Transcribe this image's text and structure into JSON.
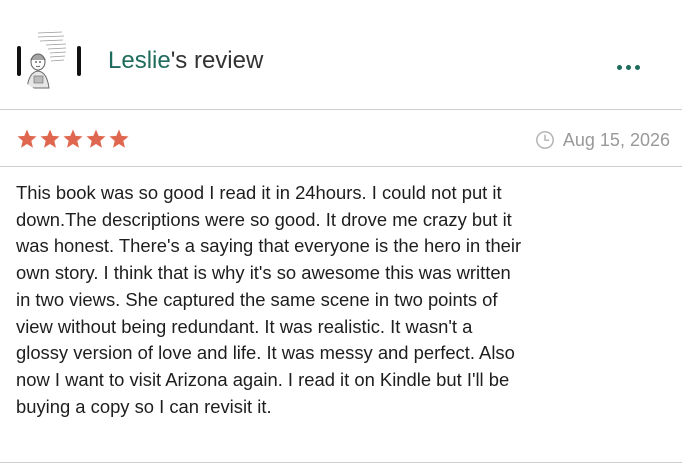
{
  "review": {
    "user_name": "Leslie",
    "title_suffix": "'s review",
    "rating": 5,
    "rating_max": 5,
    "date": "Aug 15, 2026",
    "body": "This book was so good I read it in 24hours. I could not put it\ndown.The descriptions were so good. It drove me crazy but it\nwas honest. There's a saying that everyone is the hero in their\nown story. I think that is why it's so awesome this was written\nin two views. She captured the same scene in two points of\nview without being redundant. It was realistic. It wasn't a\nglossy version of love and life. It was messy and perfect. Also\nnow I want to visit Arizona again. I read it on Kindle but I'll be\nbuying a copy so I can revisit it."
  },
  "colors": {
    "accent": "#1f6b5c",
    "star": "#e0674f",
    "muted": "#999999",
    "divider": "#cfcfcf"
  },
  "icons": {
    "more": "more-dots-icon",
    "clock": "clock-icon",
    "star": "star-icon"
  }
}
